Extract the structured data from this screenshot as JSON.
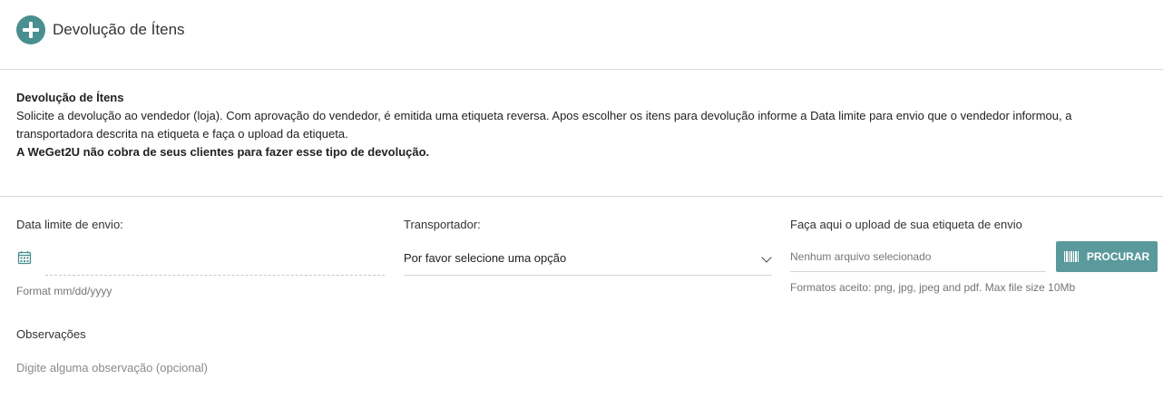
{
  "header": {
    "title": "Devolução de Ítens",
    "icon": "plus-circle-icon",
    "icon_color": "#4a8f8f"
  },
  "info": {
    "heading": "Devolução de Ítens",
    "description": "Solicite a devolução ao vendedor (loja). Com aprovação do vendedor, é emitida uma etiqueta reversa. Apos escolher os itens para devolução informe a Data limite para envio que o vendedor informou, a transportadora descrita na etiqueta e faça o upload da etiqueta.",
    "notice": "A WeGet2U não cobra de seus clientes para fazer esse tipo de devolução."
  },
  "form": {
    "date": {
      "label": "Data limite de envio:",
      "icon": "calendar-icon",
      "value": "",
      "help": "Format mm/dd/yyyy"
    },
    "carrier": {
      "label": "Transportador:",
      "selected": "Por favor selecione uma opção"
    },
    "upload": {
      "label": "Faça aqui o upload de sua etiqueta de envio",
      "file_status": "Nenhum arquivo selecionado",
      "button_label": "PROCURAR",
      "button_icon": "barcode-icon",
      "button_color": "#5a9a9c",
      "help": "Formatos aceito: png, jpg, jpeg and pdf. Max file size 10Mb"
    },
    "observations": {
      "label": "Observações",
      "placeholder": "Digite alguma observação (opcional)",
      "value": ""
    }
  }
}
